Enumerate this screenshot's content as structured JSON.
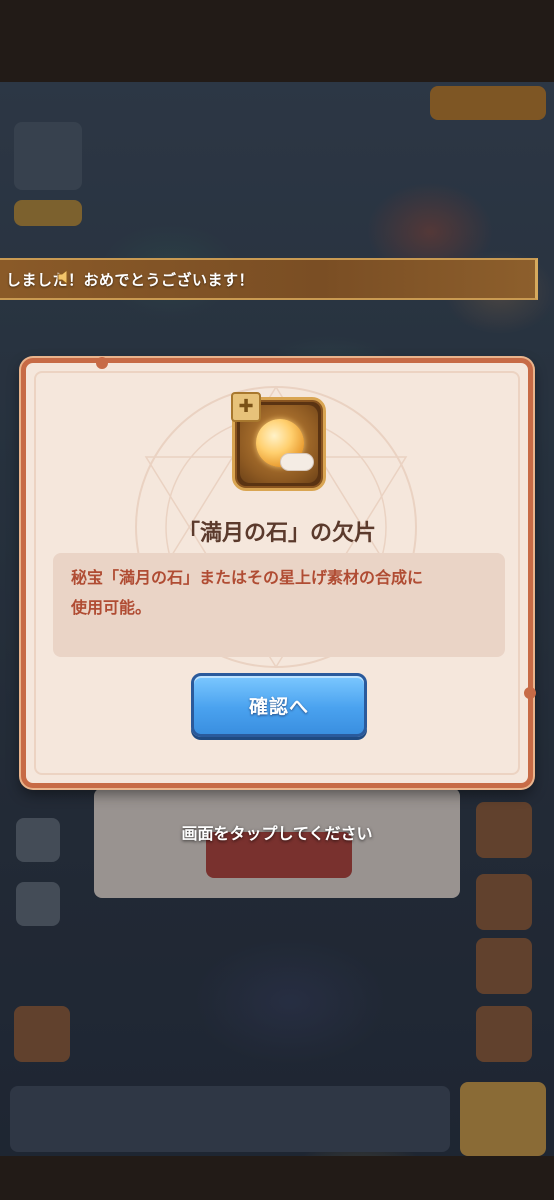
{
  "banner": {
    "text": "しました！おめでとうございます！"
  },
  "dialog": {
    "item_title": "「満月の石」の欠片",
    "description_line1": "秘宝「満月の石」またはその星上げ素材の合成に",
    "description_line2": "使用可能。",
    "confirm_label": "確認へ"
  },
  "tap_hint": "画面をタップしてください",
  "icons": {
    "item": "full-moon-stone-fragment-icon",
    "puzzle": "puzzle-piece-icon",
    "speaker": "speaker-icon"
  },
  "colors": {
    "dialog_border": "#c76b46",
    "dialog_bg": "#f5e7dc",
    "title_text": "#5b3a2c",
    "description_text": "#b04c33",
    "button_blue": "#4aa2ef",
    "banner_bg": "#8a5a28"
  }
}
